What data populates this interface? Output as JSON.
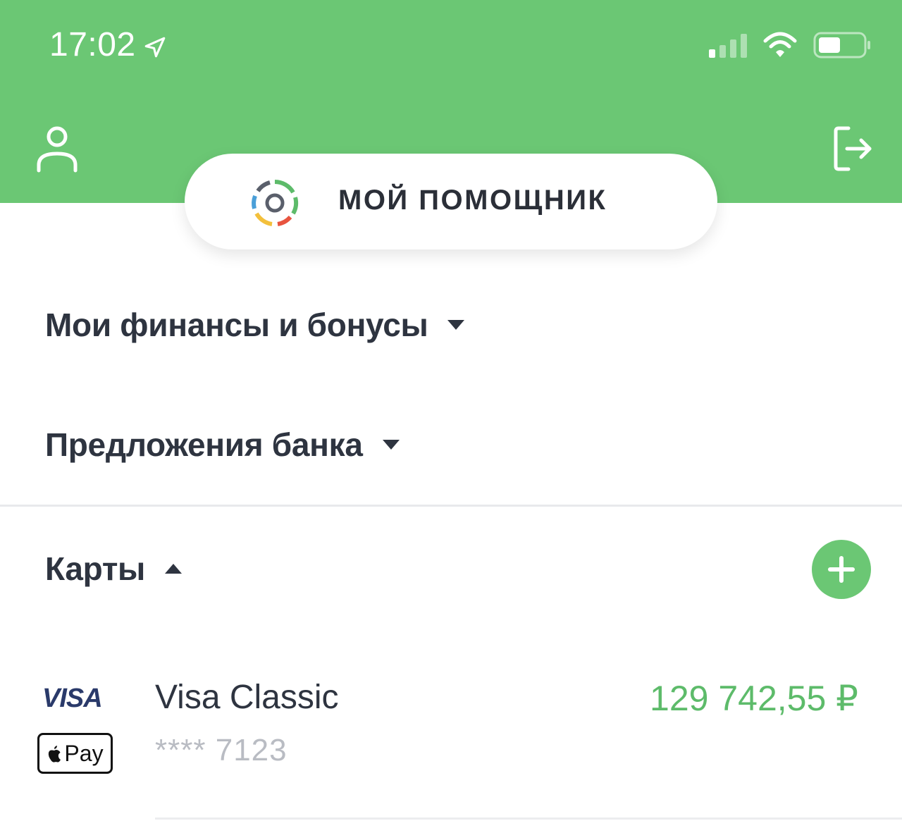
{
  "status_bar": {
    "time": "17:02",
    "icons": [
      "location-arrow-icon",
      "cellular-signal-icon",
      "wifi-icon",
      "battery-icon"
    ]
  },
  "header": {
    "profile_icon": "user-icon",
    "logout_icon": "logout-icon",
    "assistant_label": "МОЙ ПОМОЩНИК"
  },
  "sections": {
    "finances": "Мои финансы и бонусы",
    "offers": "Предложения банка",
    "cards": "Карты"
  },
  "card": {
    "brand": "VISA",
    "wallet": "Pay",
    "name": "Visa Classic",
    "number": "**** 7123",
    "balance": "129 742,55 ₽"
  },
  "colors": {
    "header_green": "#6BC774",
    "balance_green": "#5DBB6A",
    "text_dark": "#2E3440",
    "muted": "#B9BCC3"
  }
}
